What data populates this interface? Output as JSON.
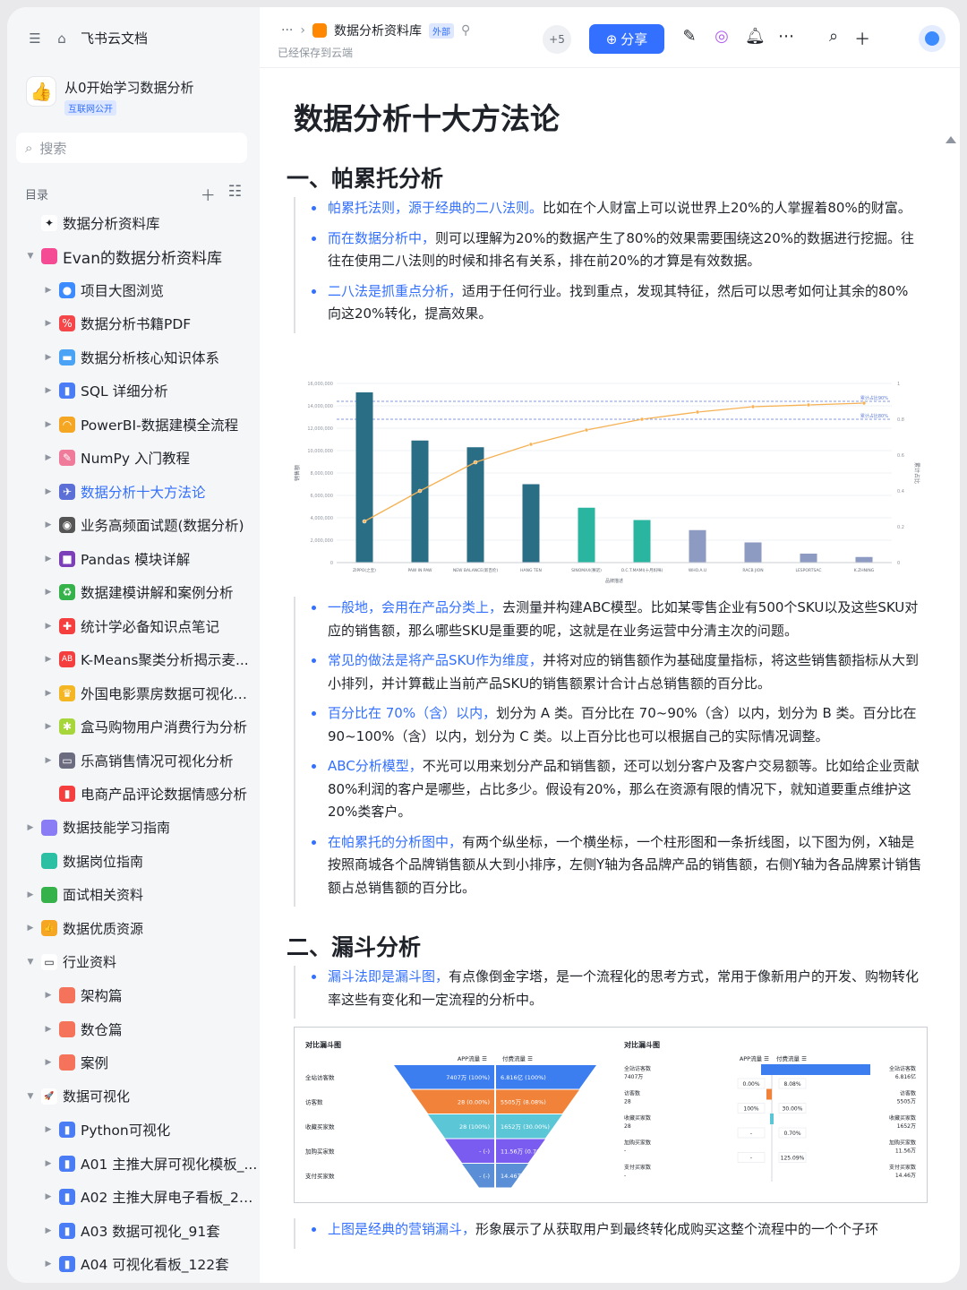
{
  "sidebar": {
    "home_label": "飞书云文档",
    "space_name": "从0开始学习数据分析",
    "space_tag": "互联网公开",
    "search_placeholder": "搜索",
    "toc_label": "目录",
    "items": [
      {
        "label": "数据分析资料库",
        "level": 0,
        "arrow": "",
        "icon_color": "#ffffff",
        "icon_glyph": "✦"
      },
      {
        "label": "Evan的数据分析资料库",
        "level": 0,
        "arrow": "▼",
        "icon_color": "#f54a94",
        "icon_glyph": ""
      },
      {
        "label": "项目大图浏览",
        "level": 1,
        "arrow": "▶",
        "icon_color": "#3c8cff",
        "icon_glyph": "●"
      },
      {
        "label": "数据分析书籍PDF",
        "level": 1,
        "arrow": "▶",
        "icon_color": "#f5474a",
        "icon_glyph": "%"
      },
      {
        "label": "数据分析核心知识体系",
        "level": 1,
        "arrow": "▶",
        "icon_color": "#4aa3f5",
        "icon_glyph": "▬"
      },
      {
        "label": "SQL 详细分析",
        "level": 1,
        "arrow": "▶",
        "icon_color": "#4a7cf5",
        "icon_glyph": "▮"
      },
      {
        "label": "PowerBI-数据建模全流程",
        "level": 1,
        "arrow": "▶",
        "icon_color": "#f5a623",
        "icon_glyph": "◠"
      },
      {
        "label": "NumPy 入门教程",
        "level": 1,
        "arrow": "▶",
        "icon_color": "#f07a9a",
        "icon_glyph": "✎"
      },
      {
        "label": "数据分析十大方法论",
        "level": 1,
        "arrow": "▶",
        "icon_color": "#5b6fd6",
        "icon_glyph": "✈",
        "active": true
      },
      {
        "label": "业务高频面试题(数据分析)",
        "level": 1,
        "arrow": "▶",
        "icon_color": "#555555",
        "icon_glyph": "◉"
      },
      {
        "label": "Pandas 模块详解",
        "level": 1,
        "arrow": "▶",
        "icon_color": "#7b3fb8",
        "icon_glyph": "■"
      },
      {
        "label": "数据建模讲解和案例分析",
        "level": 1,
        "arrow": "▶",
        "icon_color": "#35b24a",
        "icon_glyph": "♻"
      },
      {
        "label": "统计学必备知识点笔记",
        "level": 1,
        "arrow": "▶",
        "icon_color": "#f53f3f",
        "icon_glyph": "✚"
      },
      {
        "label": "K-Means聚类分析揭示麦...",
        "level": 1,
        "arrow": "▶",
        "icon_color": "#f53f3f",
        "icon_glyph": "AB"
      },
      {
        "label": "外国电影票房数据可视化分析",
        "level": 1,
        "arrow": "▶",
        "icon_color": "#f5b623",
        "icon_glyph": "♛"
      },
      {
        "label": "盒马购物用户消费行为分析",
        "level": 1,
        "arrow": "▶",
        "icon_color": "#a6d63a",
        "icon_glyph": "✱"
      },
      {
        "label": "乐高销售情况可视化分析",
        "level": 1,
        "arrow": "▶",
        "icon_color": "#6c6c80",
        "icon_glyph": "▭"
      },
      {
        "label": "电商产品评论数据情感分析",
        "level": 1,
        "arrow": "",
        "icon_color": "#f53f3f",
        "icon_glyph": "▮"
      },
      {
        "label": "数据技能学习指南",
        "level": 0,
        "arrow": "▶",
        "icon_color": "#8a7cf5",
        "icon_glyph": ""
      },
      {
        "label": "数据岗位指南",
        "level": 0,
        "arrow": "",
        "icon_color": "#2bbfa3",
        "icon_glyph": ""
      },
      {
        "label": "面试相关资料",
        "level": 0,
        "arrow": "▶",
        "icon_color": "#35b24a",
        "icon_glyph": ""
      },
      {
        "label": "数据优质资源",
        "level": 0,
        "arrow": "▶",
        "icon_color": "#f5a623",
        "icon_glyph": "👍"
      },
      {
        "label": "行业资料",
        "level": 0,
        "arrow": "▼",
        "icon_color": "#ffffff",
        "icon_glyph": "▭"
      },
      {
        "label": "架构篇",
        "level": 1,
        "arrow": "▶",
        "icon_color": "#f5735a",
        "icon_glyph": ""
      },
      {
        "label": "数仓篇",
        "level": 1,
        "arrow": "▶",
        "icon_color": "#f5735a",
        "icon_glyph": ""
      },
      {
        "label": "案例",
        "level": 1,
        "arrow": "▶",
        "icon_color": "#f5735a",
        "icon_glyph": ""
      },
      {
        "label": "数据可视化",
        "level": 0,
        "arrow": "▼",
        "icon_color": "#ffffff",
        "icon_glyph": "🚀"
      },
      {
        "label": "Python可视化",
        "level": 1,
        "arrow": "▶",
        "icon_color": "#4a7cf5",
        "icon_glyph": "▮"
      },
      {
        "label": "A01 主推大屏可视化模板_...",
        "level": 1,
        "arrow": "▶",
        "icon_color": "#4a7cf5",
        "icon_glyph": "▮"
      },
      {
        "label": "A02 主推大屏电子看板_20套",
        "level": 1,
        "arrow": "▶",
        "icon_color": "#4a7cf5",
        "icon_glyph": "▮"
      },
      {
        "label": "A03 数据可视化_91套",
        "level": 1,
        "arrow": "▶",
        "icon_color": "#4a7cf5",
        "icon_glyph": "▮"
      },
      {
        "label": "A04 可视化看板_122套",
        "level": 1,
        "arrow": "▶",
        "icon_color": "#4a7cf5",
        "icon_glyph": "▮"
      }
    ]
  },
  "topbar": {
    "crumb_dots": "···",
    "doc_name": "数据分析资料库",
    "ext_tag": "外部",
    "saved_text": "已经保存到云端",
    "collab_count": "+5",
    "share_label": "分享"
  },
  "doc": {
    "title": "数据分析十大方法论",
    "h1": "一、帕累托分析",
    "h2": "二、漏斗分析",
    "pareto_bullets_1": [
      {
        "hl": "帕累托法则，源于经典的二八法则。",
        "text": "比如在个人财富上可以说世界上20%的人掌握着80%的财富。"
      },
      {
        "hl": "而在数据分析中，",
        "text": "则可以理解为20%的数据产生了80%的效果需要围绕这20%的数据进行挖掘。往往在使用二八法则的时候和排名有关系，排在前20%的才算是有效数据。"
      },
      {
        "hl": "二八法是抓重点分析，",
        "text": "适用于任何行业。找到重点，发现其特征，然后可以思考如何让其余的80%向这20%转化，提高效果。"
      }
    ],
    "pareto_bullets_2": [
      {
        "hl": "一般地，会用在产品分类上，",
        "text": "去测量并构建ABC模型。比如某零售企业有500个SKU以及这些SKU对应的销售额，那么哪些SKU是重要的呢，这就是在业务运营中分清主次的问题。"
      },
      {
        "hl": "常见的做法是将产品SKU作为维度，",
        "text": "并将对应的销售额作为基础度量指标，将这些销售额指标从大到小排列，并计算截止当前产品SKU的销售额累计合计占总销售额的百分比。"
      },
      {
        "hl": "百分比在 70%（含）以内，",
        "text": "划分为 A 类。百分比在 70~90%（含）以内，划分为 B 类。百分比在 90~100%（含）以内，划分为 C 类。以上百分比也可以根据自己的实际情况调整。"
      },
      {
        "hl": "ABC分析模型，",
        "text": "不光可以用来划分产品和销售额，还可以划分客户及客户交易额等。比如给企业贡献80%利润的客户是哪些，占比多少。假设有20%，那么在资源有限的情况下，就知道要重点维护这20%类客户。"
      },
      {
        "hl": "在帕累托的分析图中，",
        "text": "有两个纵坐标，一个横坐标，一个柱形图和一条折线图，以下图为例，X轴是按照商城各个品牌销售额从大到小排序，左侧Y轴为各品牌产品的销售额，右侧Y轴为各品牌累计销售额占总销售额的百分比。"
      }
    ],
    "funnel_bullets_1": [
      {
        "hl": "漏斗法即是漏斗图，",
        "text": "有点像倒金字塔，是一个流程化的思考方式，常用于像新用户的开发、购物转化率这些有变化和一定流程的分析中。"
      }
    ],
    "funnel_bullets_2": [
      {
        "hl": "上图是经典的营销漏斗，",
        "text": "形象展示了从获取用户到最终转化成购买这整个流程中的一个个子环"
      }
    ]
  },
  "chart_data": [
    {
      "type": "bar",
      "title": "",
      "xlabel": "品牌描述",
      "ylabel": "销售额",
      "y2label": "累计占比",
      "categories": [
        "ZIPPO(之宝)",
        "PAW IN PAW",
        "NEW BALANCE(新百伦)",
        "HANG TEN",
        "SINOMAX(赛诺)",
        "O.C.T.MAMI(十月妈咪)",
        "WHO.A.U",
        "RACB JION",
        "LESPORTSAC",
        "K.ZHNING"
      ],
      "values": [
        15200000,
        10900000,
        10300000,
        7000000,
        4900000,
        3800000,
        2900000,
        1800000,
        800000,
        500000
      ],
      "cumulative": [
        0.23,
        0.4,
        0.56,
        0.66,
        0.74,
        0.8,
        0.84,
        0.87,
        0.88,
        0.89
      ],
      "ylim": [
        0,
        16000000
      ],
      "y2lim": [
        0,
        1
      ],
      "yticks": [
        "0",
        "2,000,000",
        "4,000,000",
        "6,000,000",
        "8,000,000",
        "10,000,000",
        "12,000,000",
        "14,000,000",
        "16,000,000"
      ],
      "y2ticks": [
        "0",
        "0.2",
        "0.4",
        "0.6",
        "0.8",
        "1"
      ],
      "ref_lines": [
        {
          "label": "累计占比90%",
          "value": 0.9
        },
        {
          "label": "累计占比80%",
          "value": 0.8
        }
      ],
      "colors": {
        "bar_top": "#2a6e86",
        "bar_mid": "#2ab5a0",
        "bar_low": "#8d9ac2",
        "line": "#f5b153"
      }
    },
    {
      "type": "bar",
      "title": "对比漏斗图",
      "series_headers": [
        "APP流量",
        "付费流量"
      ],
      "stages": [
        "全站访客数",
        "访客数",
        "收藏买家数",
        "加购买家数",
        "支付买家数"
      ],
      "left_labels": [
        "7407万 (100%)",
        "28 (0.00%)",
        "28 (100%)",
        "- (-)",
        "- (-)"
      ],
      "right_labels": [
        "6.816亿 (100%)",
        "5505万 (8.08%)",
        "1652万 (30.00%)",
        "11.56万 (0.70%)",
        "14.46万 (125.09%)"
      ],
      "colors": [
        "#3c7ef0",
        "#f0823a",
        "#5ac6d6",
        "#7a5cf0",
        "#5a8ed6"
      ]
    },
    {
      "type": "bar",
      "title": "对比漏斗图",
      "series_headers": [
        "APP流量",
        "付费流量"
      ],
      "left_stage_labels": [
        "全站访客数",
        "访客数",
        "收藏买家数",
        "加购买家数",
        "支付买家数"
      ],
      "left_values": [
        "7407万",
        "28",
        "28",
        "-",
        "-"
      ],
      "left_rates": [
        "0.00%",
        "100%",
        "-",
        "-"
      ],
      "right_rates": [
        "8.08%",
        "30.00%",
        "0.70%",
        "125.09%"
      ],
      "right_stage_labels": [
        "全站访客数",
        "访客数",
        "收藏买家数",
        "加购买家数",
        "支付买家数"
      ],
      "right_values": [
        "6.816亿",
        "5505万",
        "1652万",
        "11.56万",
        "14.46万"
      ]
    }
  ]
}
